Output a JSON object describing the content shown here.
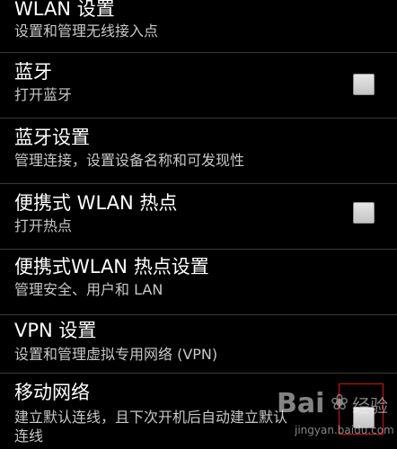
{
  "settings": [
    {
      "title": "WLAN 设置",
      "summary": "设置和管理无线接入点",
      "checkbox": false
    },
    {
      "title": "蓝牙",
      "summary": "打开蓝牙",
      "checkbox": true,
      "checked": false
    },
    {
      "title": "蓝牙设置",
      "summary": "管理连接，设置设备名称和可发现性",
      "checkbox": false
    },
    {
      "title": "便携式 WLAN 热点",
      "summary": "打开热点",
      "checkbox": true,
      "checked": false
    },
    {
      "title": "便携式WLAN 热点设置",
      "summary": "管理安全、用户和 LAN",
      "checkbox": false
    },
    {
      "title": "VPN 设置",
      "summary": "设置和管理虚拟专用网络 (VPN)",
      "checkbox": false
    },
    {
      "title": "移动网络",
      "summary": "建立默认连线，且下次开机后自动建立默认",
      "summary_cont": "连线",
      "checkbox": true,
      "checked": false
    }
  ],
  "watermark": {
    "logo_text": "Bai",
    "logo_suffix": "经验",
    "url": "jingyan.baidu.com"
  }
}
